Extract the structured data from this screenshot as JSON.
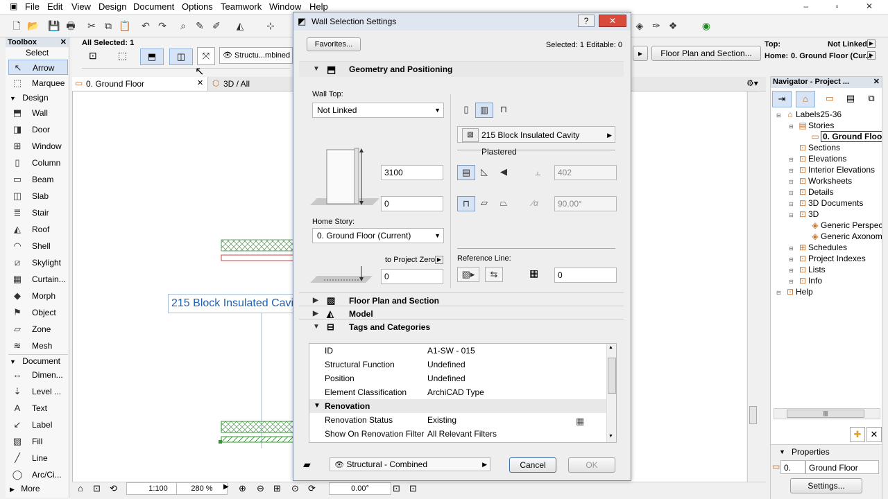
{
  "menu": [
    "File",
    "Edit",
    "View",
    "Design",
    "Document",
    "Options",
    "Teamwork",
    "Window",
    "Help"
  ],
  "window_controls": "– ▫ ✕",
  "toolbox": {
    "title": "Toolbox",
    "select_label": "Select",
    "arrow": "Arrow",
    "marquee": "Marquee",
    "design_header": "Design",
    "design_tools": [
      "Wall",
      "Door",
      "Window",
      "Column",
      "Beam",
      "Slab",
      "Stair",
      "Roof",
      "Shell",
      "Skylight",
      "Curtain...",
      "Morph",
      "Object",
      "Zone",
      "Mesh"
    ],
    "document_header": "Document",
    "document_tools": [
      "Dimen...",
      "Level ...",
      "Text",
      "Label",
      "Fill",
      "Line",
      "Arc/Ci..."
    ],
    "more": "More"
  },
  "infobox": {
    "selection": "All Selected: 1",
    "view_label": "Structu...mbined"
  },
  "tabs": {
    "ground_floor": "0. Ground Floor",
    "three_d": "3D / All"
  },
  "canvas": {
    "wall_label": "215 Block Insulated Cavi"
  },
  "statusbar": {
    "scale": "1:100",
    "zoom": "280 %",
    "angle": "0.00°"
  },
  "right_info": {
    "top_label": "Top:",
    "top_value": "Not Linked",
    "home_label": "Home:",
    "home_value": "0. Ground Floor (Cur...",
    "floorplan_button": "Floor Plan and Section..."
  },
  "navigator": {
    "title": "Navigator - Project ...",
    "tree": [
      {
        "label": "Labels25-36",
        "level": 0
      },
      {
        "label": "Stories",
        "level": 1
      },
      {
        "label": "0. Ground Floo",
        "level": 2,
        "selected": true
      },
      {
        "label": "Sections",
        "level": 1
      },
      {
        "label": "Elevations",
        "level": 1
      },
      {
        "label": "Interior Elevations",
        "level": 1
      },
      {
        "label": "Worksheets",
        "level": 1
      },
      {
        "label": "Details",
        "level": 1
      },
      {
        "label": "3D Documents",
        "level": 1
      },
      {
        "label": "3D",
        "level": 1
      },
      {
        "label": "Generic Perspec",
        "level": 2
      },
      {
        "label": "Generic Axonom",
        "level": 2
      },
      {
        "label": "Schedules",
        "level": 1
      },
      {
        "label": "Project Indexes",
        "level": 1
      },
      {
        "label": "Lists",
        "level": 1
      },
      {
        "label": "Info",
        "level": 1
      },
      {
        "label": "Help",
        "level": 0
      }
    ],
    "properties_header": "Properties",
    "properties_num": "0.",
    "properties_value": "Ground Floor",
    "settings_button": "Settings..."
  },
  "dialog": {
    "title": "Wall Selection Settings",
    "favorites_button": "Favorites...",
    "selected_info": "Selected: 1 Editable: 0",
    "geometry_header": "Geometry and Positioning",
    "wall_top_label": "Wall Top:",
    "wall_top_value": "Not Linked",
    "height_value": "3100",
    "offset_value": "0",
    "home_story_label": "Home Story:",
    "home_story_value": "0. Ground Floor (Current)",
    "to_project_zero": "to Project Zero",
    "project_zero_value": "0",
    "composite_value": "215 Block Insulated Cavity Plastered",
    "thickness_value": "402",
    "angle_value": "90.00°",
    "reference_line_label": "Reference Line:",
    "ref_offset_value": "0",
    "floorplan_header": "Floor Plan and Section",
    "model_header": "Model",
    "tags_header": "Tags and Categories",
    "tags_rows": [
      {
        "key": "ID",
        "value": "A1-SW - 015"
      },
      {
        "key": "Structural Function",
        "value": "Undefined"
      },
      {
        "key": "Position",
        "value": "Undefined"
      },
      {
        "key": "Element Classification",
        "value": "ArchiCAD Type"
      }
    ],
    "renovation_header": "Renovation",
    "renovation_rows": [
      {
        "key": "Renovation Status",
        "value": "Existing"
      },
      {
        "key": "Show On Renovation Filter",
        "value": "All Relevant Filters"
      }
    ],
    "view_dropdown": "Structural - Combined",
    "cancel_button": "Cancel",
    "ok_button": "OK",
    "help_glyph": "?",
    "close_glyph": "✕"
  }
}
